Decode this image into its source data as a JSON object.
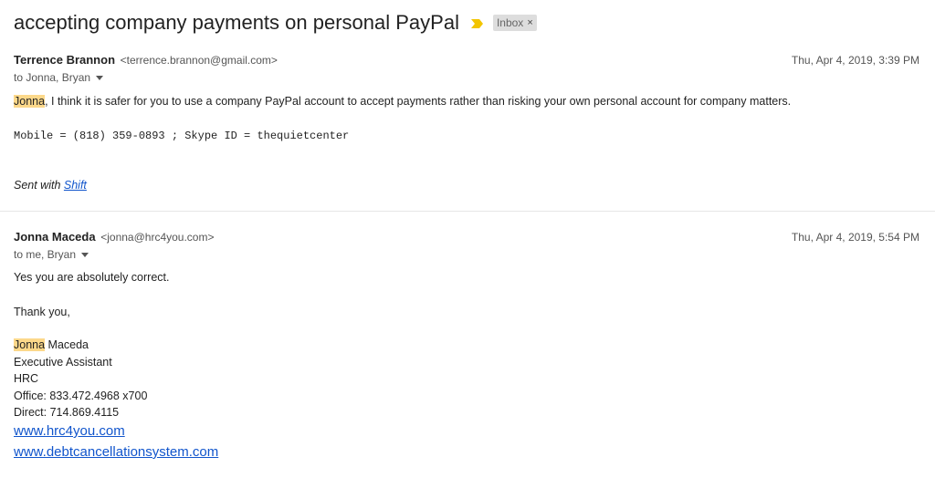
{
  "thread": {
    "subject": "accepting company payments on personal PayPal",
    "label": "Inbox",
    "label_remove": "×"
  },
  "colors": {
    "highlight": "#fcd88a",
    "importance_marker": "#f2c500",
    "link": "#1155cc"
  },
  "messages": [
    {
      "sender_name": "Terrence Brannon",
      "sender_email": "<terrence.brannon@gmail.com>",
      "date": "Thu, Apr 4, 2019, 3:39 PM",
      "to": "to Jonna, Bryan",
      "body_highlight": "Jonna",
      "body_rest": ", I think it is safer for you to use a company PayPal account to accept payments rather than risking your own personal account for company matters.",
      "contact_line": "Mobile = (818) 359-0893 ; Skype ID = thequietcenter",
      "sent_with_prefix": "Sent with ",
      "sent_with_link": "Shift"
    },
    {
      "sender_name": "Jonna Maceda",
      "sender_email": "<jonna@hrc4you.com>",
      "date": "Thu, Apr 4, 2019, 5:54 PM",
      "to": "to me, Bryan",
      "line1": "Yes you are absolutely correct.",
      "line2": "Thank you,",
      "sig_highlight": "Jonna",
      "sig_rest": " Maceda",
      "title": "Executive Assistant",
      "company": "HRC",
      "office": "Office: 833.472.4968 x700",
      "direct": "Direct:  714.869.4115",
      "link1": "www.hrc4you.com",
      "link2": "www.debtcancellationsystem.com"
    }
  ]
}
